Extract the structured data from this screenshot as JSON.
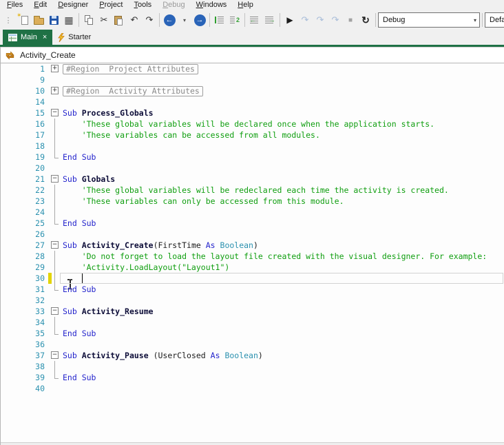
{
  "colors": {
    "chrome_bg": "#f0f0f0",
    "accent_green": "#1f7145",
    "editor_bg": "#fdfdfd",
    "gutter_number": "#2b91af",
    "keyword": "#2424cc",
    "member": "#0d0d38",
    "comment": "#0f9e0f",
    "type": "#2b91af",
    "plain": "#1b1b1b",
    "region": "#8a8a8a",
    "modified_bar": "#e3d400",
    "nav_blue": "#2a64b8",
    "combo_border": "#707070"
  },
  "menubar": {
    "items": [
      {
        "label": "Files",
        "underline": 0,
        "enabled": true
      },
      {
        "label": "Edit",
        "underline": 0,
        "enabled": true
      },
      {
        "label": "Designer",
        "underline": 0,
        "enabled": true
      },
      {
        "label": "Project",
        "underline": 0,
        "enabled": true
      },
      {
        "label": "Tools",
        "underline": 0,
        "enabled": true
      },
      {
        "label": "Debug",
        "underline": 0,
        "enabled": false
      },
      {
        "label": "Windows",
        "underline": 0,
        "enabled": true
      },
      {
        "label": "Help",
        "underline": 0,
        "enabled": true
      }
    ]
  },
  "toolbar": {
    "items": [
      {
        "name": "toolbar-grip",
        "glyph": "⋮"
      },
      {
        "name": "new-file-icon"
      },
      {
        "name": "open-project-icon"
      },
      {
        "name": "save-icon"
      },
      {
        "name": "package-icon",
        "glyph": "▦"
      },
      {
        "sep": true
      },
      {
        "name": "copy-icon"
      },
      {
        "name": "cut-icon",
        "glyph": "✂"
      },
      {
        "name": "paste-icon"
      },
      {
        "name": "undo-icon",
        "glyph": "↶"
      },
      {
        "name": "redo-icon",
        "glyph": "↷"
      },
      {
        "sep": true
      },
      {
        "name": "navigate-back-icon",
        "glyph": "←"
      },
      {
        "name": "navigate-back-dropdown-icon",
        "glyph": "▾"
      },
      {
        "name": "navigate-forward-icon",
        "glyph": "→"
      },
      {
        "sep": true
      },
      {
        "name": "comment-icon"
      },
      {
        "name": "uncomment-icon"
      },
      {
        "sep": true
      },
      {
        "name": "outdent-icon"
      },
      {
        "name": "indent-icon"
      },
      {
        "sep": true
      },
      {
        "name": "run-icon",
        "glyph": "▶"
      },
      {
        "name": "resume-icon",
        "glyph": "↷"
      },
      {
        "name": "step-into-icon",
        "glyph": "↷"
      },
      {
        "name": "step-over-icon",
        "glyph": "↷"
      },
      {
        "name": "stop-icon",
        "glyph": "■"
      },
      {
        "name": "restart-icon",
        "glyph": "↻"
      },
      {
        "sep": true
      }
    ],
    "mode_select": {
      "value": "Debug",
      "arrow_glyph": "▾"
    },
    "config_select": {
      "value": "Default"
    }
  },
  "tabs": [
    {
      "label": "Main",
      "active": true,
      "icon": "form-icon",
      "close_glyph": "×"
    },
    {
      "label": "Starter",
      "active": false,
      "icon": "lightning-icon"
    }
  ],
  "breadcrumb": {
    "icon": "sub-navigation-icon",
    "label": "Activity_Create"
  },
  "editor": {
    "caret": {
      "line": 30,
      "col": 4
    },
    "lines": [
      {
        "num": 1,
        "fold": "+",
        "region": "#Region  Project Attributes"
      },
      {
        "num": 9
      },
      {
        "num": 10,
        "fold": "+",
        "region": "#Region  Activity Attributes"
      },
      {
        "num": 14
      },
      {
        "num": 15,
        "fold": "-",
        "segs": [
          [
            "kw",
            "Sub "
          ],
          [
            "member",
            "Process_Globals"
          ]
        ]
      },
      {
        "num": 16,
        "guide": "v",
        "segs": [
          [
            "cmt",
            "    'These global variables will be declared once when the application starts."
          ]
        ]
      },
      {
        "num": 17,
        "guide": "v",
        "segs": [
          [
            "cmt",
            "    'These variables can be accessed from all modules."
          ]
        ]
      },
      {
        "num": 18,
        "guide": "v"
      },
      {
        "num": 19,
        "guide": "L",
        "segs": [
          [
            "kw",
            "End Sub"
          ]
        ]
      },
      {
        "num": 20
      },
      {
        "num": 21,
        "fold": "-",
        "segs": [
          [
            "kw",
            "Sub "
          ],
          [
            "member",
            "Globals"
          ]
        ]
      },
      {
        "num": 22,
        "guide": "v",
        "segs": [
          [
            "cmt",
            "    'These global variables will be redeclared each time the activity is created."
          ]
        ]
      },
      {
        "num": 23,
        "guide": "v",
        "segs": [
          [
            "cmt",
            "    'These variables can only be accessed from this module."
          ]
        ]
      },
      {
        "num": 24,
        "guide": "v"
      },
      {
        "num": 25,
        "guide": "L",
        "segs": [
          [
            "kw",
            "End Sub"
          ]
        ]
      },
      {
        "num": 26
      },
      {
        "num": 27,
        "fold": "-",
        "segs": [
          [
            "kw",
            "Sub "
          ],
          [
            "member",
            "Activity_Create"
          ],
          [
            "plain",
            "(FirstTime "
          ],
          [
            "kw",
            "As "
          ],
          [
            "type",
            "Boolean"
          ],
          [
            "plain",
            ")"
          ]
        ]
      },
      {
        "num": 28,
        "guide": "v",
        "segs": [
          [
            "cmt",
            "    'Do not forget to load the layout file created with the visual designer. For example:"
          ]
        ]
      },
      {
        "num": 29,
        "guide": "v",
        "segs": [
          [
            "cmt",
            "    'Activity.LoadLayout(\"Layout1\")"
          ]
        ]
      },
      {
        "num": 30,
        "guide": "v",
        "modified": true,
        "current": true
      },
      {
        "num": 31,
        "guide": "L",
        "segs": [
          [
            "kw",
            "End Sub"
          ]
        ]
      },
      {
        "num": 32
      },
      {
        "num": 33,
        "fold": "-",
        "segs": [
          [
            "kw",
            "Sub "
          ],
          [
            "member",
            "Activity_Resume"
          ]
        ]
      },
      {
        "num": 34,
        "guide": "v"
      },
      {
        "num": 35,
        "guide": "L",
        "segs": [
          [
            "kw",
            "End Sub"
          ]
        ]
      },
      {
        "num": 36
      },
      {
        "num": 37,
        "fold": "-",
        "segs": [
          [
            "kw",
            "Sub "
          ],
          [
            "member",
            "Activity_Pause "
          ],
          [
            "plain",
            "(UserClosed "
          ],
          [
            "kw",
            "As "
          ],
          [
            "type",
            "Boolean"
          ],
          [
            "plain",
            ")"
          ]
        ]
      },
      {
        "num": 38,
        "guide": "v"
      },
      {
        "num": 39,
        "guide": "L",
        "segs": [
          [
            "kw",
            "End Sub"
          ]
        ]
      },
      {
        "num": 40
      }
    ]
  }
}
